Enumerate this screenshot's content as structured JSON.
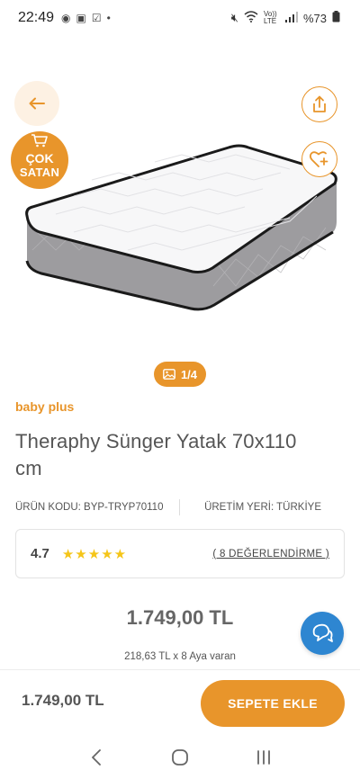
{
  "status_bar": {
    "time": "22:49",
    "battery": "%73",
    "network": "Vo)) LTE"
  },
  "hero": {
    "badge_line1": "ÇOK",
    "badge_line2": "SATAN",
    "pager": "1/4"
  },
  "product": {
    "brand": "baby plus",
    "title": "Theraphy Sünger Yatak 70x110 cm",
    "code_label": "ÜRÜN KODU: BYP-TRYP70110",
    "origin_label": "ÜRETİM YERİ: TÜRKİYE",
    "rating_score": "4.7",
    "stars": "★★★★★",
    "rating_value": 5,
    "reviews_label": "( 8 DEĞERLENDİRME )",
    "price": "1.749,00 TL",
    "installment": "218,63 TL x 8 Aya varan"
  },
  "bottom_bar": {
    "price": "1.749,00 TL",
    "add_to_cart_label": "SEPETE EKLE"
  },
  "colors": {
    "accent": "#e8952b",
    "chat": "#2e86d1",
    "star": "#f5c518"
  },
  "icons": [
    "back-arrow-icon",
    "share-icon",
    "heart-plus-icon",
    "cart-icon",
    "image-icon",
    "chat-icon",
    "nav-back-icon",
    "nav-home-icon",
    "nav-recents-icon"
  ]
}
